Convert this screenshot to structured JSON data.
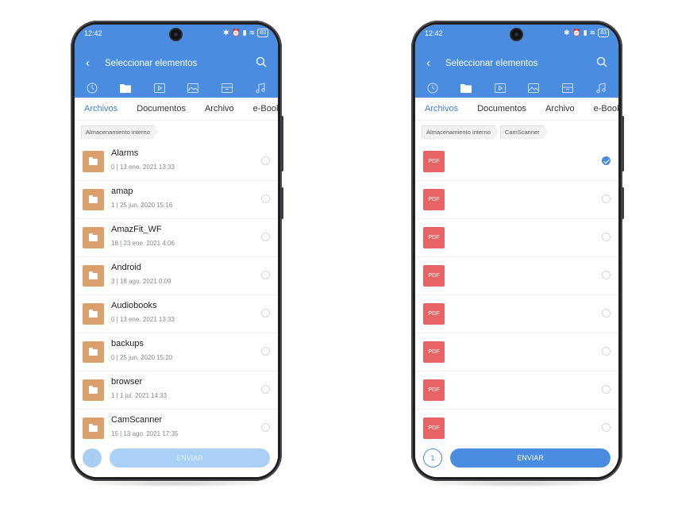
{
  "status": {
    "time": "12:42",
    "battery": "83"
  },
  "appbar": {
    "title": "Seleccionar elementos"
  },
  "tabs": [
    "Archivos",
    "Documentos",
    "Archivo",
    "e-Books"
  ],
  "colors": {
    "accent": "#4a8de0",
    "folder": "#d9a06e",
    "pdf": "#e86464"
  },
  "categories": [
    "recent-icon",
    "folder-icon",
    "video-icon",
    "image-icon",
    "archive-icon",
    "music-icon"
  ],
  "left_screen": {
    "breadcrumb": [
      "Almacenamiento interno"
    ],
    "items": [
      {
        "name": "Alarms",
        "meta": "0 | 13 ene. 2021 13:33"
      },
      {
        "name": "amap",
        "meta": "1 | 25 jun. 2020 15:16"
      },
      {
        "name": "AmazFit_WF",
        "meta": "18 | 23 ene. 2021 4:06"
      },
      {
        "name": "Android",
        "meta": "3 | 18 ago. 2021 0:09"
      },
      {
        "name": "Audiobooks",
        "meta": "0 | 13 ene. 2021 13:33"
      },
      {
        "name": "backups",
        "meta": "0 | 25 jun. 2020 15:20"
      },
      {
        "name": "browser",
        "meta": "1 | 1 jul. 2021 14:33"
      },
      {
        "name": "CamScanner",
        "meta": "15 | 13 ago. 2021 17:35"
      }
    ],
    "selected_count": "0",
    "send_label": "ENVIAR"
  },
  "right_screen": {
    "breadcrumb": [
      "Almacenamiento interno",
      "CamScanner"
    ],
    "file_badge": "PDF",
    "file_count": 8,
    "checked_index": 0,
    "selected_count": "1",
    "send_label": "ENVIAR"
  }
}
